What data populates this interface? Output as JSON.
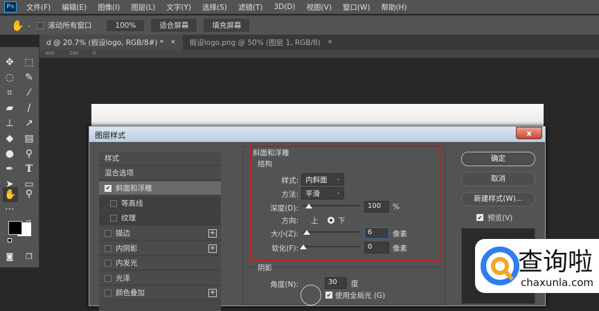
{
  "menubar": {
    "logo": "Ps",
    "items": [
      "文件(F)",
      "编辑(E)",
      "图像(I)",
      "图层(L)",
      "文字(Y)",
      "选择(S)",
      "滤镜(T)",
      "3D(D)",
      "视图(V)",
      "窗口(W)",
      "帮助(H)"
    ]
  },
  "options": {
    "tool_icon": "hand-icon",
    "scroll_all": "滚动所有窗口",
    "zoom": "100%",
    "fit_screen": "适合屏幕",
    "fill_screen": "填充屏幕"
  },
  "tabs": [
    {
      "label": "d @ 20.7% (假设logo, RGB/8#) *",
      "close": "×"
    },
    {
      "label": "假设logo.png @ 50% (图层 1, RGB/8)",
      "close": "×"
    }
  ],
  "ruler": [
    "400",
    "200",
    "0"
  ],
  "dialog": {
    "title": "图层样式",
    "close": "x",
    "list": [
      {
        "label": "样式",
        "type": "header"
      },
      {
        "label": "混合选项",
        "type": "header"
      },
      {
        "label": "斜面和浮雕",
        "checked": true,
        "selected": true
      },
      {
        "label": "等高线",
        "checked": false,
        "sub": true
      },
      {
        "label": "纹理",
        "checked": false,
        "sub": true
      },
      {
        "label": "描边",
        "checked": false,
        "plus": true
      },
      {
        "label": "内阴影",
        "checked": false,
        "plus": true
      },
      {
        "label": "内发光",
        "checked": false
      },
      {
        "label": "光泽",
        "checked": false
      },
      {
        "label": "颜色叠加",
        "checked": false,
        "plus": true
      }
    ],
    "bevel": {
      "group": "斜面和浮雕",
      "structure": "结构",
      "style_label": "样式:",
      "style_value": "内斜面",
      "technique_label": "方法:",
      "technique_value": "平滑",
      "depth_label": "深度(D):",
      "depth_value": "100",
      "depth_unit": "%",
      "direction_label": "方向:",
      "dir_up": "上",
      "dir_down": "下",
      "direction_selected": "下",
      "size_label": "大小(Z):",
      "size_value": "6",
      "size_unit": "像素",
      "soften_label": "软化(F):",
      "soften_value": "0",
      "soften_unit": "像素",
      "highlight_color": "#b3262a"
    },
    "shading": {
      "title": "阴影",
      "angle_label": "角度(N):",
      "angle_value": "30",
      "angle_unit": "度",
      "global_light": "使用全局光 (G)",
      "global_light_checked": true
    },
    "buttons": {
      "ok": "确定",
      "cancel": "取消",
      "new_style": "新建样式(W)...",
      "preview": "预览(V)",
      "preview_checked": true
    }
  },
  "watermark": {
    "text": "查询啦",
    "url": "chaxunla.com"
  }
}
